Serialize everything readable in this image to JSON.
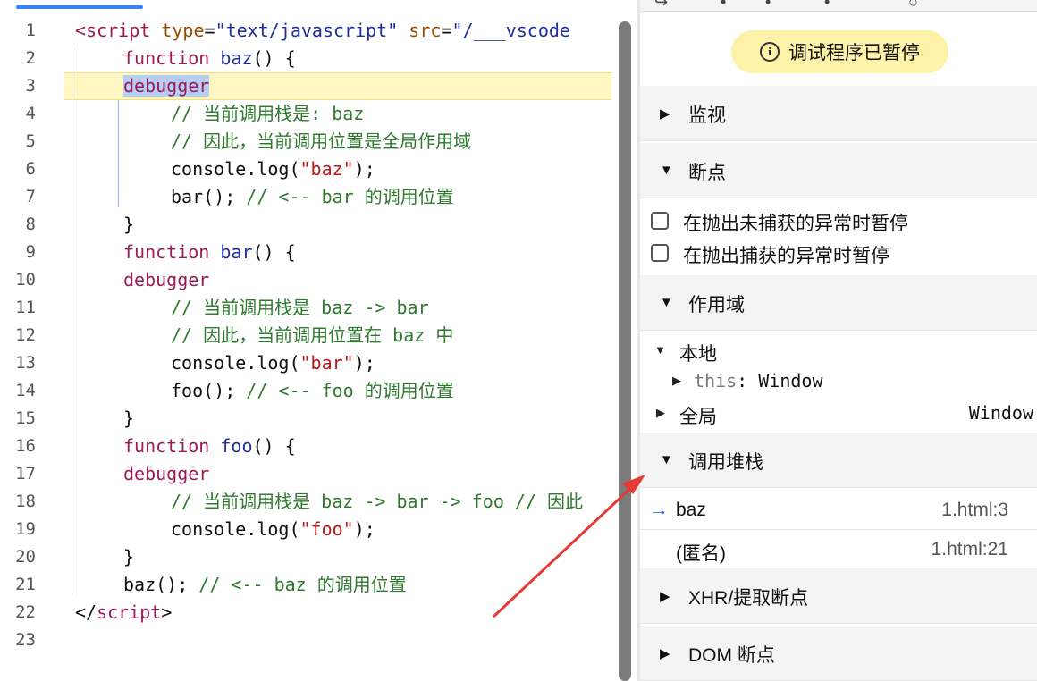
{
  "editor": {
    "line_numbers": [
      "1",
      "2",
      "3",
      "4",
      "5",
      "6",
      "7",
      "8",
      "9",
      "10",
      "11",
      "12",
      "13",
      "14",
      "15",
      "16",
      "17",
      "18",
      "19",
      "20",
      "21",
      "22",
      "23"
    ],
    "line1": {
      "open": "<script",
      "attr1": " type",
      "eq1": "=",
      "val1": "\"text/javascript\"",
      "attr2": " src",
      "eq2": "=",
      "val2": "\"/___vscode"
    },
    "line2": {
      "kw": "function",
      "name": " baz",
      "rest": "() {"
    },
    "line3": {
      "kw": "debugger"
    },
    "line4": {
      "cmt": "// 当前调用栈是: baz"
    },
    "line5": {
      "cmt": "// 因此，当前调用位置是全局作用域"
    },
    "line6": {
      "pre": "console.log(",
      "str": "\"baz\"",
      "post": ");"
    },
    "line7": {
      "code": "bar(); ",
      "cmt": "// <-- bar 的调用位置"
    },
    "line8": {
      "code": "}"
    },
    "line9": {
      "kw": "function",
      "name": " bar",
      "rest": "() {"
    },
    "line10": {
      "kw": "debugger"
    },
    "line11": {
      "cmt": "// 当前调用栈是 baz -> bar"
    },
    "line12": {
      "cmt": "// 因此，当前调用位置在 baz 中"
    },
    "line13": {
      "pre": "console.log(",
      "str": "\"bar\"",
      "post": ");"
    },
    "line14": {
      "code": "foo(); ",
      "cmt": "// <-- foo 的调用位置"
    },
    "line15": {
      "code": "}"
    },
    "line16": {
      "kw": "function",
      "name": " foo",
      "rest": "() {"
    },
    "line17": {
      "kw": "debugger"
    },
    "line18": {
      "cmt": "// 当前调用栈是 baz -> bar -> foo // 因此"
    },
    "line19": {
      "pre": "console.log(",
      "str": "\"foo\"",
      "post": ");"
    },
    "line20": {
      "code": "}"
    },
    "line21": {
      "code": "baz(); ",
      "cmt": "// <-- baz 的调用位置"
    },
    "line22": {
      "open": "</",
      "tag": "script",
      "close": ">"
    },
    "line23": {
      "code": ""
    }
  },
  "panel": {
    "banner": {
      "icon": "i",
      "text": "调试程序已暂停"
    },
    "watch": {
      "label": "监视"
    },
    "breakpoints": {
      "label": "断点",
      "options": [
        "在抛出未捕获的异常时暂停",
        "在抛出捕获的异常时暂停"
      ]
    },
    "scope": {
      "label": "作用域",
      "local": "本地",
      "this_key": "this",
      "this_sep": ": ",
      "this_val": "Window",
      "global": "全局",
      "global_val": "Window"
    },
    "callstack": {
      "label": "调用堆栈",
      "frames": [
        {
          "name": "baz",
          "location": "1.html:3"
        },
        {
          "name": "(匿名)",
          "location": "1.html:21"
        }
      ]
    },
    "xhr": {
      "label": "XHR/提取断点"
    },
    "dom": {
      "label": "DOM 断点"
    }
  },
  "colors": {
    "accent": "#3b82f6",
    "banner": "#fdf2a8",
    "highlight_line": "#fff6c2",
    "annotation_arrow": "#e53935"
  }
}
